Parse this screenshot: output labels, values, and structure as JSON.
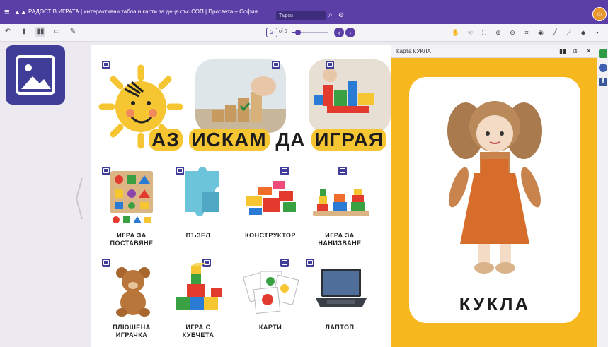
{
  "topbar": {
    "title": "РАДОСТ В ИГРАТА | интерактивни табла и карти за деца със СОП | Просвета – София",
    "search_placeholder": "Търси",
    "menu_icon": "hamburger-icon",
    "search_icon": "search-icon",
    "settings_icon": "gear-icon"
  },
  "toolbar": {
    "page_current": "2",
    "page_of": "of 0",
    "zoom_fraction": 0.18,
    "left_icons": [
      "back-icon",
      "single-page-icon",
      "double-page-icon",
      "spread-icon",
      "edit-icon"
    ],
    "right_icons": [
      "hand-icon",
      "pointer-icon",
      "fullscreen-icon",
      "zoom-in-icon",
      "zoom-out-icon",
      "crop-icon",
      "eye-icon",
      "pen-icon",
      "highlighter-icon",
      "eraser-icon",
      "more-icon"
    ]
  },
  "board": {
    "heading_words": [
      "АЗ",
      "ИСКАМ",
      "ДА",
      "ИГРАЯ"
    ],
    "items": [
      {
        "label_line1": "ИГРА ЗА",
        "label_line2": "ПОСТАВЯНЕ"
      },
      {
        "label_line1": "ПЪЗЕЛ",
        "label_line2": ""
      },
      {
        "label_line1": "КОНСТРУКТОР",
        "label_line2": ""
      },
      {
        "label_line1": "ИГРА ЗА",
        "label_line2": "НАНИЗВАНЕ"
      },
      {
        "label_line1": "ПЛЮШЕНА",
        "label_line2": "ИГРАЧКА"
      },
      {
        "label_line1": "ИГРА С",
        "label_line2": "КУБЧЕТА"
      },
      {
        "label_line1": "КАРТИ",
        "label_line2": ""
      },
      {
        "label_line1": "ЛАПТОП",
        "label_line2": ""
      }
    ]
  },
  "card": {
    "window_title": "Карта КУКЛА",
    "label": "КУКЛА"
  },
  "colors": {
    "brand": "#5b3fa6",
    "accent_yellow": "#f6b81e",
    "icon_blue": "#3f3d98"
  }
}
